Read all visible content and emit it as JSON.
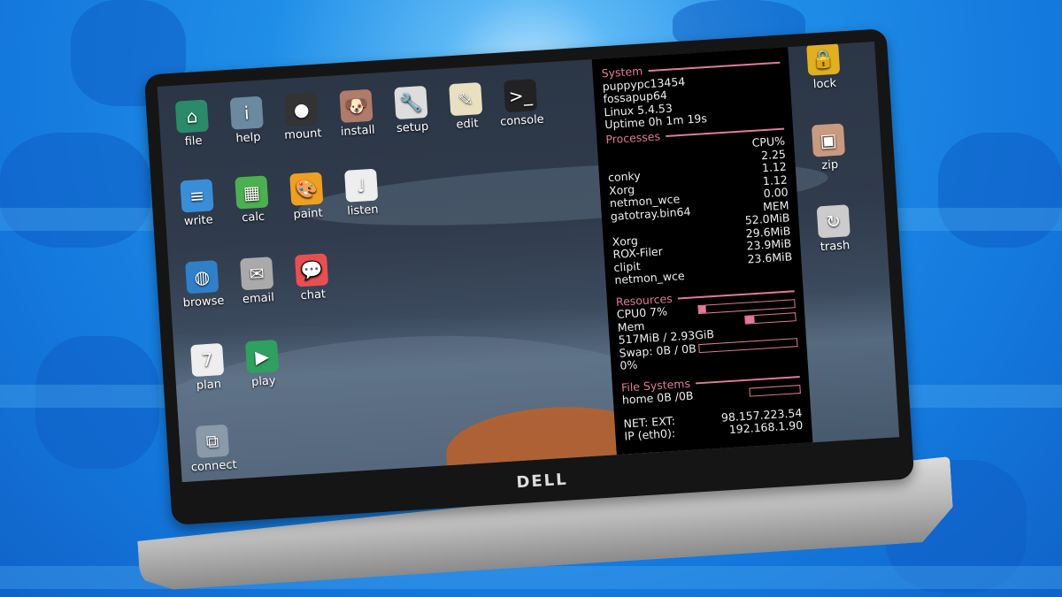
{
  "desktop": {
    "icons": [
      {
        "label": "file",
        "icon": "home-icon",
        "color": "#2a8a6a"
      },
      {
        "label": "help",
        "icon": "info-icon",
        "color": "#6b8aa0"
      },
      {
        "label": "mount",
        "icon": "disk-icon",
        "color": "#333333"
      },
      {
        "label": "install",
        "icon": "puppy-icon",
        "color": "#b07b6a"
      },
      {
        "label": "setup",
        "icon": "wrench-icon",
        "color": "#dddddd"
      },
      {
        "label": "edit",
        "icon": "pencil-icon",
        "color": "#e8e0c0"
      },
      {
        "label": "console",
        "icon": "terminal-icon",
        "color": "#222222"
      },
      {
        "label": "write",
        "icon": "document-icon",
        "color": "#3a8ed8"
      },
      {
        "label": "calc",
        "icon": "spreadsheet-icon",
        "color": "#4caf50"
      },
      {
        "label": "paint",
        "icon": "palette-icon",
        "color": "#f0a020"
      },
      {
        "label": "listen",
        "icon": "music-note-icon",
        "color": "#eeeeee"
      },
      {
        "label": "browse",
        "icon": "globe-icon",
        "color": "#2f80c8"
      },
      {
        "label": "email",
        "icon": "envelope-icon",
        "color": "#aaaaaa"
      },
      {
        "label": "chat",
        "icon": "chat-bubbles-icon",
        "color": "#e85050"
      },
      {
        "label": "plan",
        "icon": "calendar-icon",
        "color": "#eeeeee",
        "glyph": "7"
      },
      {
        "label": "play",
        "icon": "play-icon",
        "color": "#2fa060"
      },
      {
        "label": "connect",
        "icon": "network-icon",
        "color": "#8a9aa8"
      }
    ],
    "right_icons": [
      {
        "label": "lock",
        "icon": "padlock-icon",
        "color": "#e0b020"
      },
      {
        "label": "zip",
        "icon": "archive-icon",
        "color": "#c89a80"
      },
      {
        "label": "trash",
        "icon": "trash-icon",
        "color": "#cccccc"
      }
    ]
  },
  "conky": {
    "system_header": "System",
    "hostname": "puppypc13454",
    "distro": "fossapup64",
    "kernel": "Linux 5.4.53",
    "uptime": "Uptime 0h 1m 19s",
    "processes_header": "Processes",
    "cpu_header": "CPU%",
    "cpu_procs": [
      {
        "name": "",
        "value": "2.25"
      },
      {
        "name": "conky",
        "value": "1.12"
      },
      {
        "name": "Xorg",
        "value": "1.12"
      },
      {
        "name": "netmon_wce",
        "value": "0.00"
      }
    ],
    "mem_lead_name": "gatotray.bin64",
    "mem_header": "MEM",
    "mem_procs": [
      {
        "name": "",
        "value": "52.0MiB"
      },
      {
        "name": "Xorg",
        "value": "29.6MiB"
      },
      {
        "name": "ROX-Filer",
        "value": "23.9MiB"
      },
      {
        "name": "clipit",
        "value": "23.6MiB"
      },
      {
        "name": "netmon_wce",
        "value": ""
      }
    ],
    "resources_header": "Resources",
    "cpu0": "CPU0 7%",
    "cpu_fill": 7,
    "mem_label": "Mem",
    "mem_fill": 17,
    "mem_usage": "517MiB / 2.93GiB",
    "swap": "Swap: 0B   / 0B",
    "swap_pct": "0%",
    "swap_fill": 0,
    "fs_header": "File Systems",
    "fs_fill": 0,
    "home": "home 0B  /0B",
    "net_label": "NET: EXT:",
    "ext_ip": "98.157.223.54",
    "ip_label": "IP (eth0):",
    "local_ip": "192.168.1.90",
    "accent": "#e27b97"
  },
  "laptop": {
    "brand": "DELL"
  }
}
